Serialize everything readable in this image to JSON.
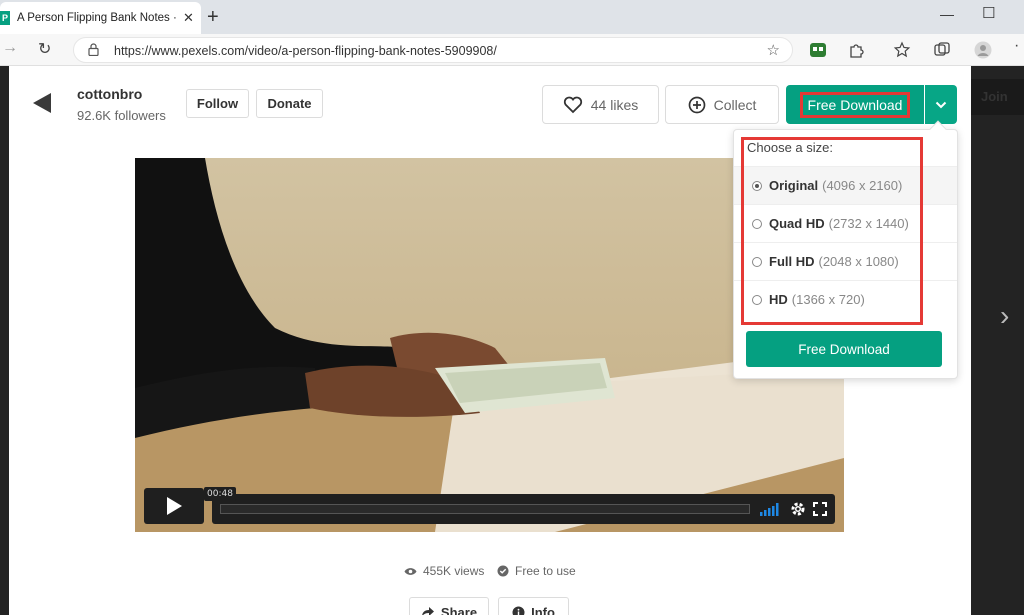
{
  "browser": {
    "tab_title": "A Person Flipping Bank Notes · F",
    "favicon_letter": "P",
    "url": "https://www.pexels.com/video/a-person-flipping-bank-notes-5909908/"
  },
  "background_page": {
    "join_label": "Join"
  },
  "author": {
    "name": "cottonbro",
    "followers": "92.6K followers"
  },
  "buttons": {
    "follow": "Follow",
    "donate": "Donate",
    "likes": "44 likes",
    "collect": "Collect",
    "free_download": "Free Download"
  },
  "video": {
    "timestamp": "00:48"
  },
  "download_menu": {
    "title": "Choose a size:",
    "options": [
      {
        "name": "Original",
        "dims": "(4096 x 2160)",
        "selected": true
      },
      {
        "name": "Quad HD",
        "dims": "(2732 x 1440)",
        "selected": false
      },
      {
        "name": "Full HD",
        "dims": "(2048 x 1080)",
        "selected": false
      },
      {
        "name": "HD",
        "dims": "(1366 x 720)",
        "selected": false
      }
    ],
    "button": "Free Download"
  },
  "stats": {
    "views": "455K views",
    "license": "Free to use"
  },
  "footer_buttons": {
    "share": "Share",
    "info": "Info"
  },
  "colors": {
    "brand_green": "#05a081",
    "highlight_red": "#e53935"
  }
}
